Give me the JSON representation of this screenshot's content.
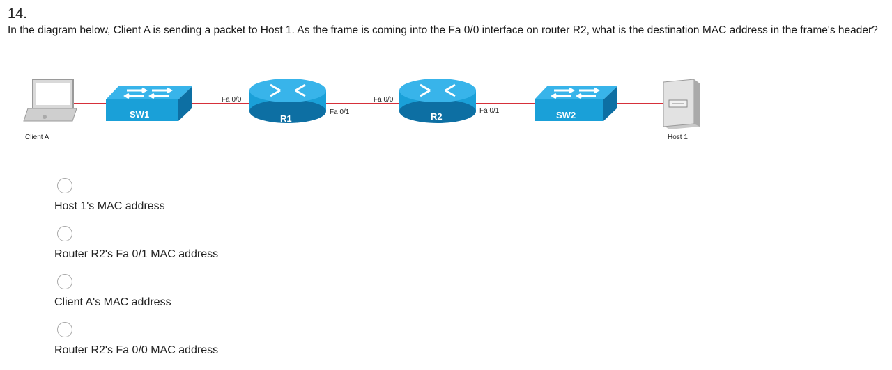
{
  "question": {
    "number": "14.",
    "text": "In the diagram below, Client A is sending a packet to Host 1. As the frame is coming into the Fa 0/0 interface on router R2, what is the destination MAC address in the frame's header?"
  },
  "diagram": {
    "client": "Client A",
    "sw1": "SW1",
    "r1": "R1",
    "r1_fa00": "Fa 0/0",
    "r1_fa01": "Fa 0/1",
    "r2": "R2",
    "r2_fa00": "Fa 0/0",
    "r2_fa01": "Fa 0/1",
    "sw2": "SW2",
    "host": "Host 1",
    "colors": {
      "link": "#d6303a",
      "device": "#1aa0d8",
      "device_dark": "#0d6fa3"
    }
  },
  "options": [
    {
      "label": "Host 1's MAC address",
      "selected": false
    },
    {
      "label": "Router R2's Fa 0/1 MAC address",
      "selected": false
    },
    {
      "label": "Client A's MAC address",
      "selected": false
    },
    {
      "label": "Router R2's Fa 0/0 MAC address",
      "selected": false
    }
  ]
}
